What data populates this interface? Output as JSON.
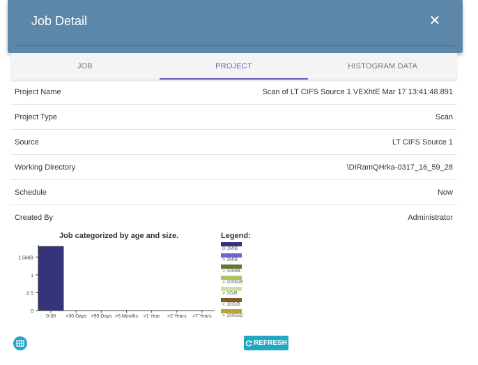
{
  "dialog": {
    "title": "Job Detail"
  },
  "tabs": [
    {
      "label": "JOB",
      "active": false
    },
    {
      "label": "PROJECT",
      "active": true
    },
    {
      "label": "HISTOGRAM DATA",
      "active": false
    }
  ],
  "details": [
    {
      "label": "Project Name",
      "value": "Scan of LT CIFS Source 1 VEXhtE Mar 17 13:41:48.891"
    },
    {
      "label": "Project Type",
      "value": "Scan"
    },
    {
      "label": "Source",
      "value": "LT CIFS Source 1"
    },
    {
      "label": "Working Directory",
      "value": "\\DIRamQHrka-0317_16_59_28"
    },
    {
      "label": "Schedule",
      "value": "Now"
    },
    {
      "label": "Created By",
      "value": "Administrator"
    }
  ],
  "chart_data": {
    "type": "bar",
    "title": "Job categorized by age and size.",
    "categories": [
      "0-30",
      ">30 Days",
      ">90 Days",
      ">6 Months",
      ">1 Year",
      ">2 Years",
      ">7 Years"
    ],
    "series": [
      {
        "name": "0-1MiB",
        "color": "#35347a",
        "values": [
          1.8,
          0,
          0,
          0,
          0,
          0,
          0
        ]
      }
    ],
    "yticks": [
      "0",
      "0.5",
      "1",
      "1.5MiB"
    ],
    "ytick_values": [
      0,
      0.5,
      1,
      1.5
    ],
    "ylim": [
      0,
      1.8
    ]
  },
  "legend": {
    "title": "Legend:",
    "items": [
      {
        "label": "0-1MiB",
        "color": "#35347a"
      },
      {
        "label": "> 1MiB",
        "color": "#6a65cf"
      },
      {
        "label": "> 10MiB",
        "color": "#5e7a2f"
      },
      {
        "label": "> 100MiB",
        "color": "#a9c760"
      },
      {
        "label": "> 1GiB",
        "color": "#cfe0a5"
      },
      {
        "label": "> 10GiB",
        "color": "#7d5a2a"
      },
      {
        "label": "> 100GiB",
        "color": "#bfa03a"
      }
    ]
  },
  "actions": {
    "refresh_label": "REFRESH",
    "grid_icon": "grid-view-icon",
    "refresh_icon": "refresh-icon"
  },
  "colors": {
    "header": "#5d87a8",
    "accent": "#6a5fc1",
    "button": "#21a9c4"
  }
}
